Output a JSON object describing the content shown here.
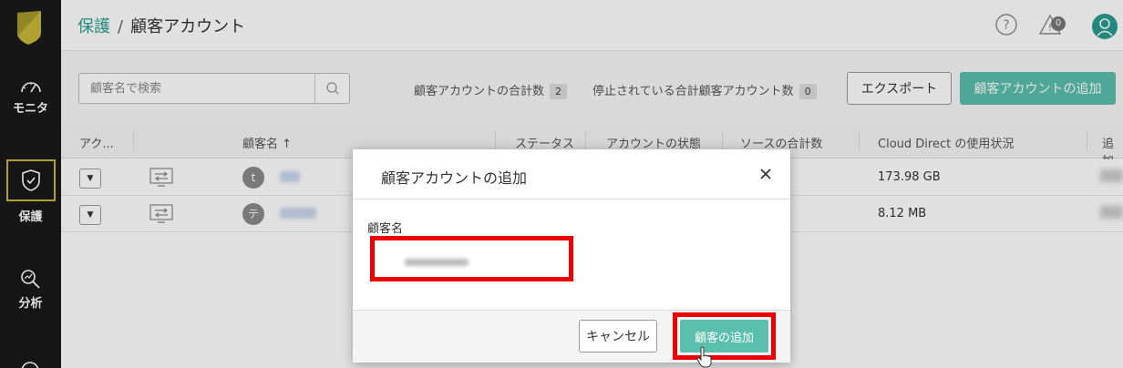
{
  "app": {
    "brand_color": "#c8b83a",
    "accent_color": "#5bbfad",
    "link_color": "#2a9d8f"
  },
  "nav": {
    "items": [
      {
        "label": "モニタ",
        "icon": "gauge-icon"
      },
      {
        "label": "保護",
        "icon": "shield-check-icon",
        "active": true
      },
      {
        "label": "分析",
        "icon": "analyze-search-icon"
      }
    ]
  },
  "header": {
    "breadcrumb_link": "保護",
    "separator": "/",
    "title": "顧客アカウント",
    "notification_count": "0"
  },
  "toolbar": {
    "search_placeholder": "顧客名で検索",
    "total_label": "顧客アカウントの合計数",
    "total_count": "2",
    "stopped_label": "停止されている合計顧客アカウント数",
    "stopped_count": "0",
    "export_label": "エクスポート",
    "add_label": "顧客アカウントの追加"
  },
  "table": {
    "columns": [
      "アク...",
      "顧客名 ↑",
      "ステータス",
      "アカウントの状態",
      "ソースの合計数",
      "Cloud Direct の使用状況",
      "追加"
    ],
    "rows": [
      {
        "avatar": "t",
        "usage": "173.98 GB"
      },
      {
        "avatar": "テ",
        "usage": "8.12 MB"
      }
    ]
  },
  "modal": {
    "title": "顧客アカウントの追加",
    "field_label": "顧客名",
    "cancel_label": "キャンセル",
    "confirm_label": "顧客の追加"
  }
}
